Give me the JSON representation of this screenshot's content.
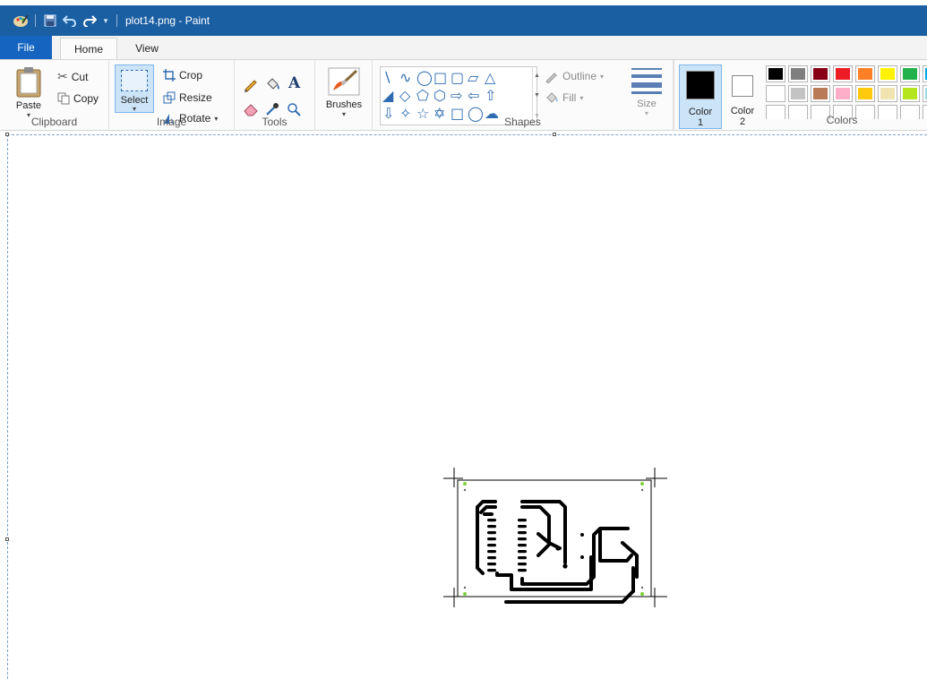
{
  "window": {
    "title": "plot14.png - Paint"
  },
  "icons": {
    "app": "paint-app-icon",
    "save": "save-icon",
    "undo": "undo-icon",
    "redo": "redo-icon",
    "customize": "qat-customize-icon"
  },
  "tabs": {
    "file": "File",
    "home": "Home",
    "view": "View"
  },
  "clipboard": {
    "paste": "Paste",
    "cut": "Cut",
    "copy": "Copy",
    "label": "Clipboard"
  },
  "image": {
    "select": "Select",
    "crop": "Crop",
    "resize": "Resize",
    "rotate": "Rotate",
    "label": "Image"
  },
  "tools": {
    "label": "Tools"
  },
  "brushes": {
    "label": "Brushes"
  },
  "shapes": {
    "outline": "Outline",
    "fill": "Fill",
    "label": "Shapes"
  },
  "size": {
    "label": "Size"
  },
  "colors": {
    "color1_line1": "Color",
    "color1_line2": "1",
    "color2_line1": "Color",
    "color2_line2": "2",
    "label": "Colors",
    "color1_value": "#000000",
    "color2_value": "#ffffff",
    "palette_row1": [
      "#000000",
      "#7f7f7f",
      "#880015",
      "#ed1c24",
      "#ff7f27",
      "#fff200",
      "#22b14c",
      "#00a2e8"
    ],
    "palette_row2": [
      "#ffffff",
      "#c3c3c3",
      "#b97a57",
      "#ffaec9",
      "#ffc90e",
      "#efe4b0",
      "#b5e61d",
      "#99d9ea"
    ],
    "palette_row3": [
      "",
      "",
      "",
      "",
      "",
      "",
      "",
      ""
    ]
  },
  "accent": {
    "titlebar": "#1b5fa3",
    "file_tab": "#1565c0",
    "selected_button": "#cce4f7"
  }
}
